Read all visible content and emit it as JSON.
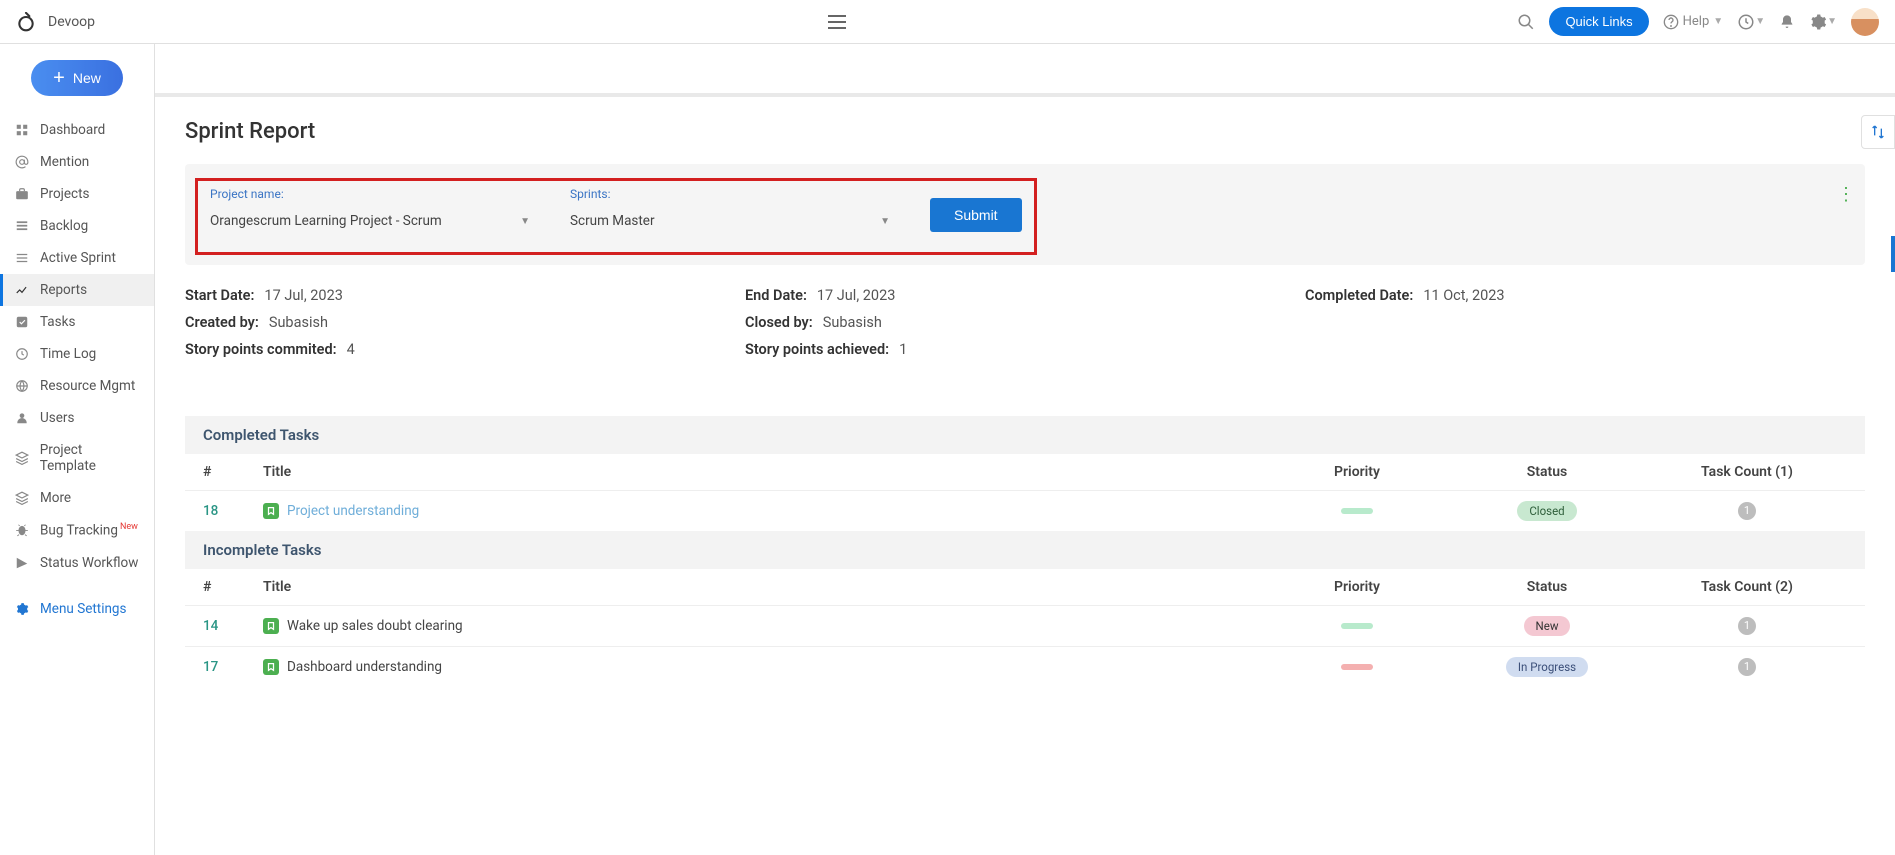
{
  "header": {
    "brand": "Devoop",
    "quick_links": "Quick Links",
    "help_label": "Help"
  },
  "sidebar": {
    "new_button": "New",
    "items": [
      {
        "label": "Dashboard",
        "icon": "dashboard"
      },
      {
        "label": "Mention",
        "icon": "mention"
      },
      {
        "label": "Projects",
        "icon": "briefcase"
      },
      {
        "label": "Backlog",
        "icon": "layers"
      },
      {
        "label": "Active Sprint",
        "icon": "lines"
      },
      {
        "label": "Reports",
        "icon": "chart",
        "active": true
      },
      {
        "label": "Tasks",
        "icon": "check"
      },
      {
        "label": "Time Log",
        "icon": "clock"
      },
      {
        "label": "Resource Mgmt",
        "icon": "globe"
      },
      {
        "label": "Users",
        "icon": "user"
      },
      {
        "label": "Project Template",
        "icon": "stack"
      },
      {
        "label": "More",
        "icon": "stack"
      },
      {
        "label": "Bug Tracking",
        "icon": "bug",
        "badge": "New"
      },
      {
        "label": "Status Workflow",
        "icon": "flow"
      }
    ],
    "menu_settings": "Menu Settings"
  },
  "page": {
    "title": "Sprint Report",
    "filters": {
      "project_label": "Project name:",
      "project_value": "Orangescrum Learning Project - Scrum",
      "sprint_label": "Sprints:",
      "sprint_value": "Scrum Master",
      "submit": "Submit"
    },
    "meta": {
      "start_date_label": "Start Date:",
      "start_date_value": "17 Jul, 2023",
      "end_date_label": "End Date:",
      "end_date_value": "17 Jul, 2023",
      "completed_date_label": "Completed Date:",
      "completed_date_value": "11 Oct, 2023",
      "created_by_label": "Created by:",
      "created_by_value": "Subasish",
      "closed_by_label": "Closed by:",
      "closed_by_value": "Subasish",
      "sp_committed_label": "Story points commited:",
      "sp_committed_value": "4",
      "sp_achieved_label": "Story points achieved:",
      "sp_achieved_value": "1"
    },
    "columns": {
      "num": "#",
      "title": "Title",
      "priority": "Priority",
      "status": "Status",
      "task_count_completed": "Task Count (1)",
      "task_count_incomplete": "Task Count (2)"
    },
    "completed_section": "Completed Tasks",
    "completed_tasks": [
      {
        "id": "18",
        "title": "Project understanding",
        "priority": "low",
        "status_label": "Closed",
        "status_class": "st-closed",
        "count": "1",
        "link": true
      }
    ],
    "incomplete_section": "Incomplete Tasks",
    "incomplete_tasks": [
      {
        "id": "14",
        "title": "Wake up sales doubt clearing",
        "priority": "low",
        "status_label": "New",
        "status_class": "st-new",
        "count": "1",
        "link": false
      },
      {
        "id": "17",
        "title": "Dashboard understanding",
        "priority": "med",
        "status_label": "In Progress",
        "status_class": "st-progress",
        "count": "1",
        "link": false
      }
    ]
  }
}
